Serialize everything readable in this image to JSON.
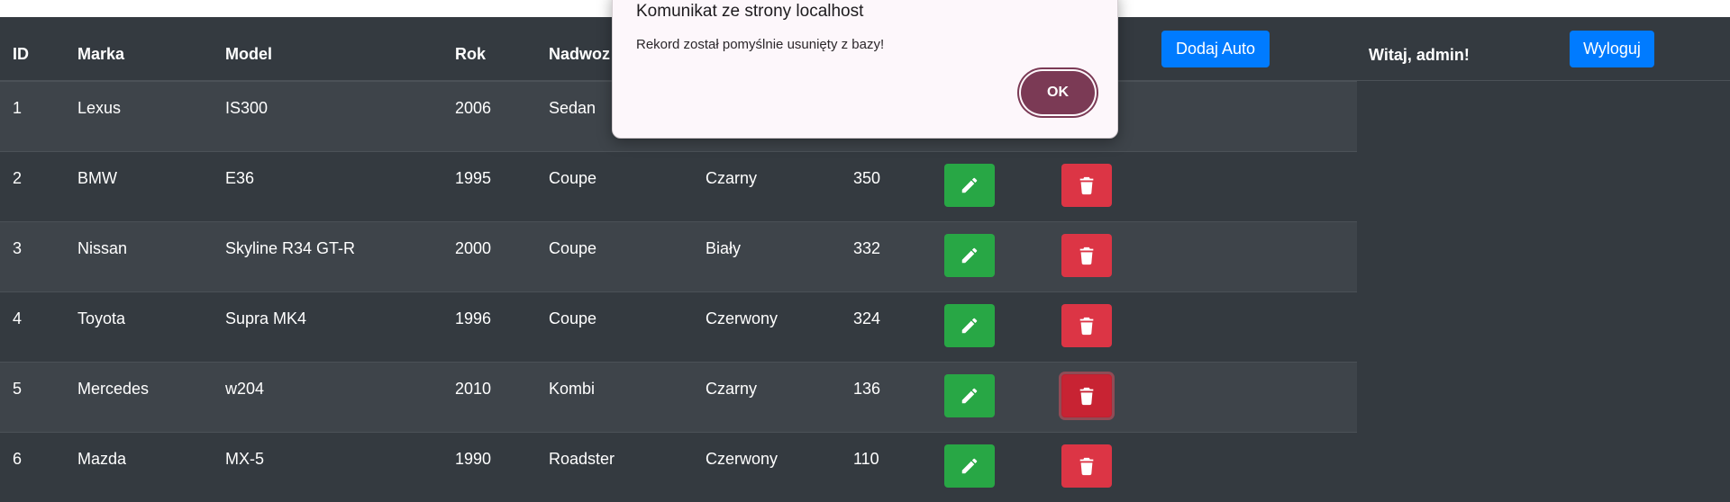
{
  "table": {
    "columns": [
      "ID",
      "Marka",
      "Model",
      "Rok",
      "Nadwoz"
    ],
    "rows": [
      {
        "id": "1",
        "marka": "Lexus",
        "model": "IS300",
        "rok": "2006",
        "nadwozie": "Sedan",
        "kolor": "",
        "moc": ""
      },
      {
        "id": "2",
        "marka": "BMW",
        "model": "E36",
        "rok": "1995",
        "nadwozie": "Coupe",
        "kolor": "Czarny",
        "moc": "350"
      },
      {
        "id": "3",
        "marka": "Nissan",
        "model": "Skyline R34 GT-R",
        "rok": "2000",
        "nadwozie": "Coupe",
        "kolor": "Biały",
        "moc": "332"
      },
      {
        "id": "4",
        "marka": "Toyota",
        "model": "Supra MK4",
        "rok": "1996",
        "nadwozie": "Coupe",
        "kolor": "Czerwony",
        "moc": "324"
      },
      {
        "id": "5",
        "marka": "Mercedes",
        "model": "w204",
        "rok": "2010",
        "nadwozie": "Kombi",
        "kolor": "Czarny",
        "moc": "136"
      },
      {
        "id": "6",
        "marka": "Mazda",
        "model": "MX-5",
        "rok": "1990",
        "nadwozie": "Roadster",
        "kolor": "Czerwony",
        "moc": "110"
      }
    ]
  },
  "header": {
    "add_car_label": "Dodaj Auto",
    "welcome_text": "Witaj, admin!",
    "logout_label": "Wyloguj"
  },
  "dialog": {
    "title": "Komunikat ze strony localhost",
    "message": "Rekord został pomyślnie usunięty z bazy!",
    "ok_label": "OK"
  },
  "icons": {
    "edit": "pencil-icon",
    "delete": "trash-icon"
  },
  "colors": {
    "background": "#343a40",
    "edit_button": "#28a745",
    "delete_button": "#dc3545",
    "primary_button": "#007bff",
    "dialog_ok": "#7b3a55"
  }
}
